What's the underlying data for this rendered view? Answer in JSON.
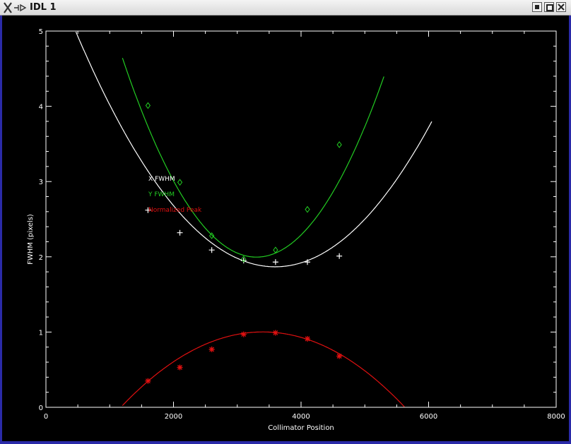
{
  "window": {
    "title": "IDL 1",
    "app_icon": "x-logo-icon",
    "buttons": [
      "minimize-icon",
      "maximize-icon",
      "close-icon"
    ]
  },
  "colors": {
    "background": "#000000",
    "axes": "#ffffff",
    "x_fwhm": "#ffffff",
    "y_fwhm": "#22cc22",
    "peak": "#e01010"
  },
  "chart_data": {
    "type": "scatter",
    "xlabel": "Collimator Position",
    "ylabel": "FWHM (pixels)",
    "xlim": [
      0,
      8000
    ],
    "ylim": [
      0,
      5
    ],
    "xticks": [
      "0",
      "2000",
      "4000",
      "6000",
      "8000"
    ],
    "yticks": [
      "0",
      "1",
      "2",
      "3",
      "4",
      "5"
    ],
    "legend": [
      "X FWHM",
      "Y FWHM",
      "Normalized Peak"
    ],
    "series": [
      {
        "name": "X FWHM",
        "marker": "plus",
        "x": [
          1600,
          2100,
          2600,
          3100,
          3600,
          4100,
          4600
        ],
        "y": [
          2.62,
          2.32,
          2.09,
          1.95,
          1.93,
          1.93,
          2.01
        ],
        "fit": [
          3.2e-07,
          -0.0023,
          6.0
        ]
      },
      {
        "name": "Y FWHM",
        "marker": "diamond",
        "x": [
          1600,
          2100,
          2600,
          3100,
          3600,
          4100,
          4600
        ],
        "y": [
          4.01,
          2.99,
          2.28,
          1.97,
          2.09,
          2.63,
          3.49
        ],
        "fit": [
          6e-07,
          -0.00396,
          8.53
        ]
      },
      {
        "name": "Normalized Peak",
        "marker": "asterisk",
        "x": [
          1600,
          2100,
          2600,
          3100,
          3600,
          4100,
          4600
        ],
        "y": [
          0.35,
          0.53,
          0.77,
          0.97,
          0.99,
          0.91,
          0.68
        ],
        "fit": [
          -2.02e-07,
          0.001374,
          -1.335
        ]
      }
    ]
  }
}
